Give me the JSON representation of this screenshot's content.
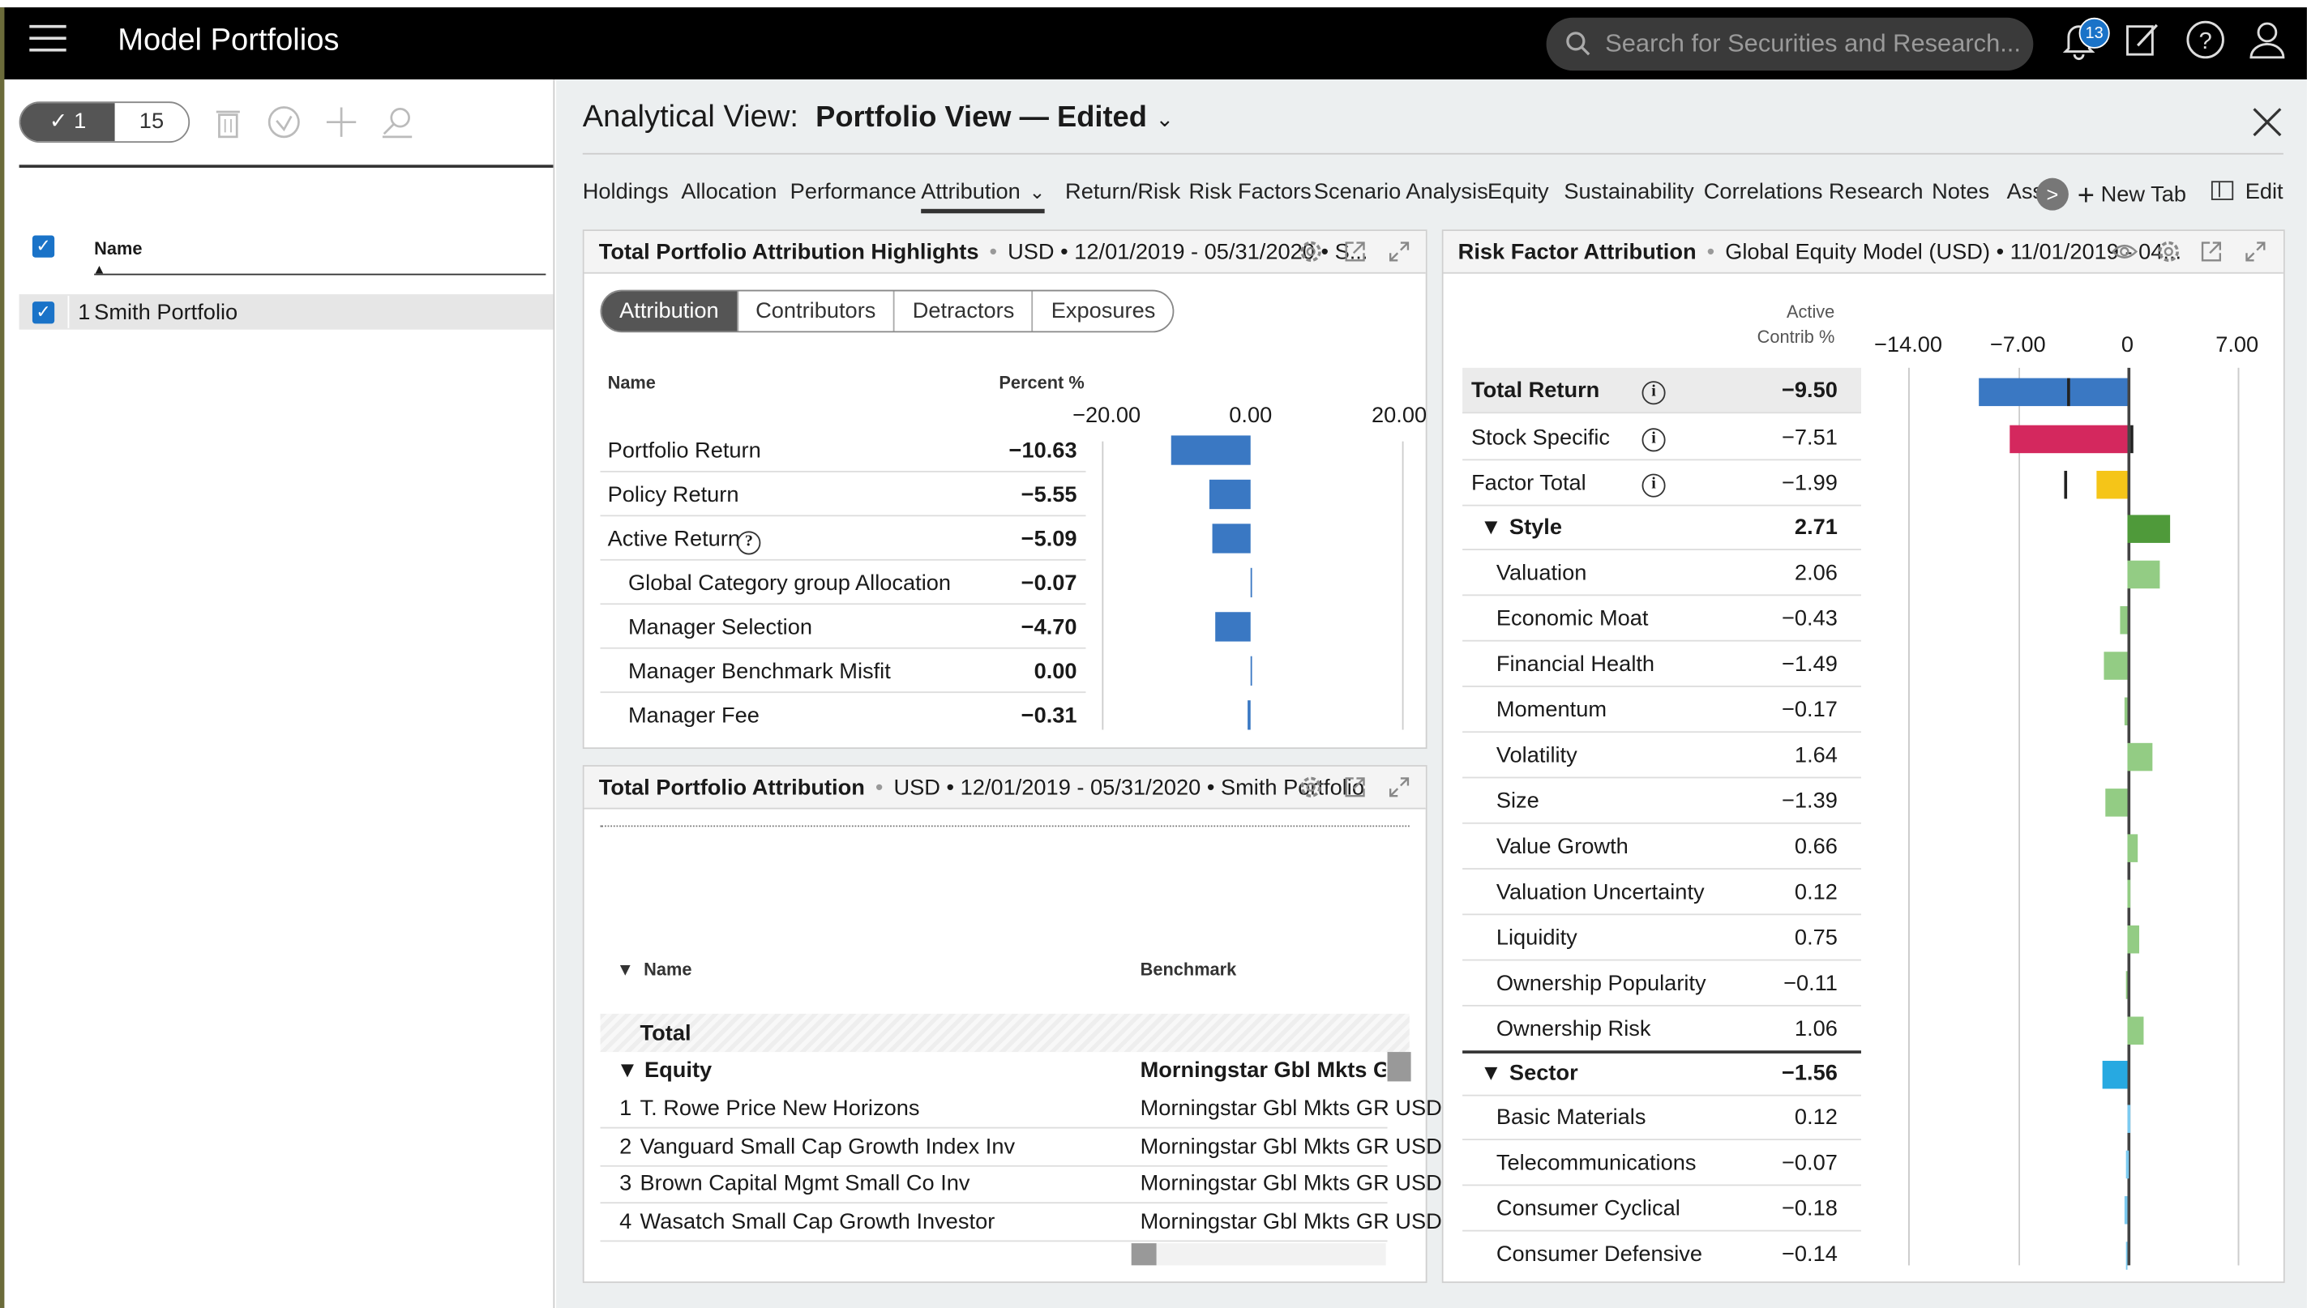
{
  "app": {
    "title": "Model Portfolios",
    "search_placeholder": "Search for Securities and Research...",
    "notifications": "13"
  },
  "left": {
    "selected_count": "1",
    "total_count": "15",
    "name_header": "Name",
    "rows": [
      {
        "index": "1",
        "name": "Smith Portfolio"
      }
    ]
  },
  "view": {
    "label": "Analytical View:",
    "name": "Portfolio View — Edited"
  },
  "tabs": [
    "Holdings",
    "Allocation",
    "Performance",
    "Attribution",
    "Return/Risk",
    "Risk Factors",
    "Scenario Analysis",
    "Equity",
    "Sustainability",
    "Correlations",
    "Research",
    "Notes",
    "Ass"
  ],
  "new_tab": "New Tab",
  "edit": "Edit",
  "highlights": {
    "title": "Total Portfolio Attribution Highlights",
    "sub": "USD • 12/01/2019 - 05/31/2020 • S...",
    "pills": [
      "Attribution",
      "Contributors",
      "Detractors",
      "Exposures"
    ],
    "col_name": "Name",
    "col_pct": "Percent %",
    "axis": [
      "−20.00",
      "0.00",
      "20.00"
    ],
    "rows": [
      {
        "name": "Portfolio Return",
        "value": "−10.63",
        "v": -10.63,
        "bold": true,
        "indent": false
      },
      {
        "name": "Policy Return",
        "value": "−5.55",
        "v": -5.55,
        "bold": true,
        "indent": false
      },
      {
        "name": "Active Return",
        "value": "−5.09",
        "v": -5.09,
        "bold": true,
        "indent": false,
        "info": "?"
      },
      {
        "name": "Global Category group Allocation",
        "value": "−0.07",
        "v": -0.07,
        "bold": true,
        "indent": true
      },
      {
        "name": "Manager Selection",
        "value": "−4.70",
        "v": -4.7,
        "bold": true,
        "indent": true
      },
      {
        "name": "Manager Benchmark Misfit",
        "value": "0.00",
        "v": 0.0,
        "bold": true,
        "indent": true
      },
      {
        "name": "Manager Fee",
        "value": "−0.31",
        "v": -0.31,
        "bold": true,
        "indent": true
      }
    ]
  },
  "tpa": {
    "title": "Total Portfolio Attribution",
    "sub": "USD • 12/01/2019 - 05/31/2020 • Smith Portfolio",
    "col_name": "Name",
    "col_bench": "Benchmark",
    "total": "Total",
    "group": "Equity",
    "group_bench": "Morningstar Gbl Mkts GR US",
    "rows": [
      {
        "i": "1",
        "name": "T. Rowe Price New Horizons",
        "bench": "Morningstar Gbl Mkts GR USD"
      },
      {
        "i": "2",
        "name": "Vanguard Small Cap Growth Index Inv",
        "bench": "Morningstar Gbl Mkts GR USD"
      },
      {
        "i": "3",
        "name": "Brown Capital Mgmt Small Co Inv",
        "bench": "Morningstar Gbl Mkts GR USD"
      },
      {
        "i": "4",
        "name": "Wasatch Small Cap Growth Investor",
        "bench": "Morningstar Gbl Mkts GR USD"
      }
    ]
  },
  "rfa": {
    "title": "Risk Factor Attribution",
    "sub": "Global Equity Model (USD) • 11/01/2019 - 04...",
    "col1": "Active",
    "col2": "Contrib %",
    "axis": [
      "−14.00",
      "−7.00",
      "0",
      "7.00"
    ],
    "colors": {
      "total": "#3a78c3",
      "stock": "#d4285e",
      "factor": "#f5c518",
      "style": "#4f9a3a",
      "styleitem": "#93cc84",
      "sector": "#27a9e1",
      "sectoritem": "#7ccaf0"
    },
    "rows": [
      {
        "name": "Total Return",
        "value": "−9.50",
        "v": -9.5,
        "kind": "total",
        "info": "i"
      },
      {
        "name": "Stock Specific",
        "value": "−7.51",
        "v": -7.51,
        "kind": "stock",
        "info": "i"
      },
      {
        "name": "Factor Total",
        "value": "−1.99",
        "v": -1.99,
        "kind": "factor",
        "info": "i"
      },
      {
        "name": "Style",
        "value": "2.71",
        "v": 2.71,
        "kind": "style"
      },
      {
        "name": "Valuation",
        "value": "2.06",
        "v": 2.06,
        "kind": "styleitem"
      },
      {
        "name": "Economic Moat",
        "value": "−0.43",
        "v": -0.43,
        "kind": "styleitem"
      },
      {
        "name": "Financial Health",
        "value": "−1.49",
        "v": -1.49,
        "kind": "styleitem"
      },
      {
        "name": "Momentum",
        "value": "−0.17",
        "v": -0.17,
        "kind": "styleitem"
      },
      {
        "name": "Volatility",
        "value": "1.64",
        "v": 1.64,
        "kind": "styleitem"
      },
      {
        "name": "Size",
        "value": "−1.39",
        "v": -1.39,
        "kind": "styleitem"
      },
      {
        "name": "Value Growth",
        "value": "0.66",
        "v": 0.66,
        "kind": "styleitem"
      },
      {
        "name": "Valuation Uncertainty",
        "value": "0.12",
        "v": 0.12,
        "kind": "styleitem"
      },
      {
        "name": "Liquidity",
        "value": "0.75",
        "v": 0.75,
        "kind": "styleitem"
      },
      {
        "name": "Ownership Popularity",
        "value": "−0.11",
        "v": -0.11,
        "kind": "styleitem"
      },
      {
        "name": "Ownership Risk",
        "value": "1.06",
        "v": 1.06,
        "kind": "styleitem"
      },
      {
        "name": "Sector",
        "value": "−1.56",
        "v": -1.56,
        "kind": "sector"
      },
      {
        "name": "Basic Materials",
        "value": "0.12",
        "v": 0.12,
        "kind": "sectoritem"
      },
      {
        "name": "Telecommunications",
        "value": "−0.07",
        "v": -0.07,
        "kind": "sectoritem"
      },
      {
        "name": "Consumer Cyclical",
        "value": "−0.18",
        "v": -0.18,
        "kind": "sectoritem"
      },
      {
        "name": "Consumer Defensive",
        "value": "−0.14",
        "v": -0.14,
        "kind": "sectoritem"
      }
    ]
  }
}
